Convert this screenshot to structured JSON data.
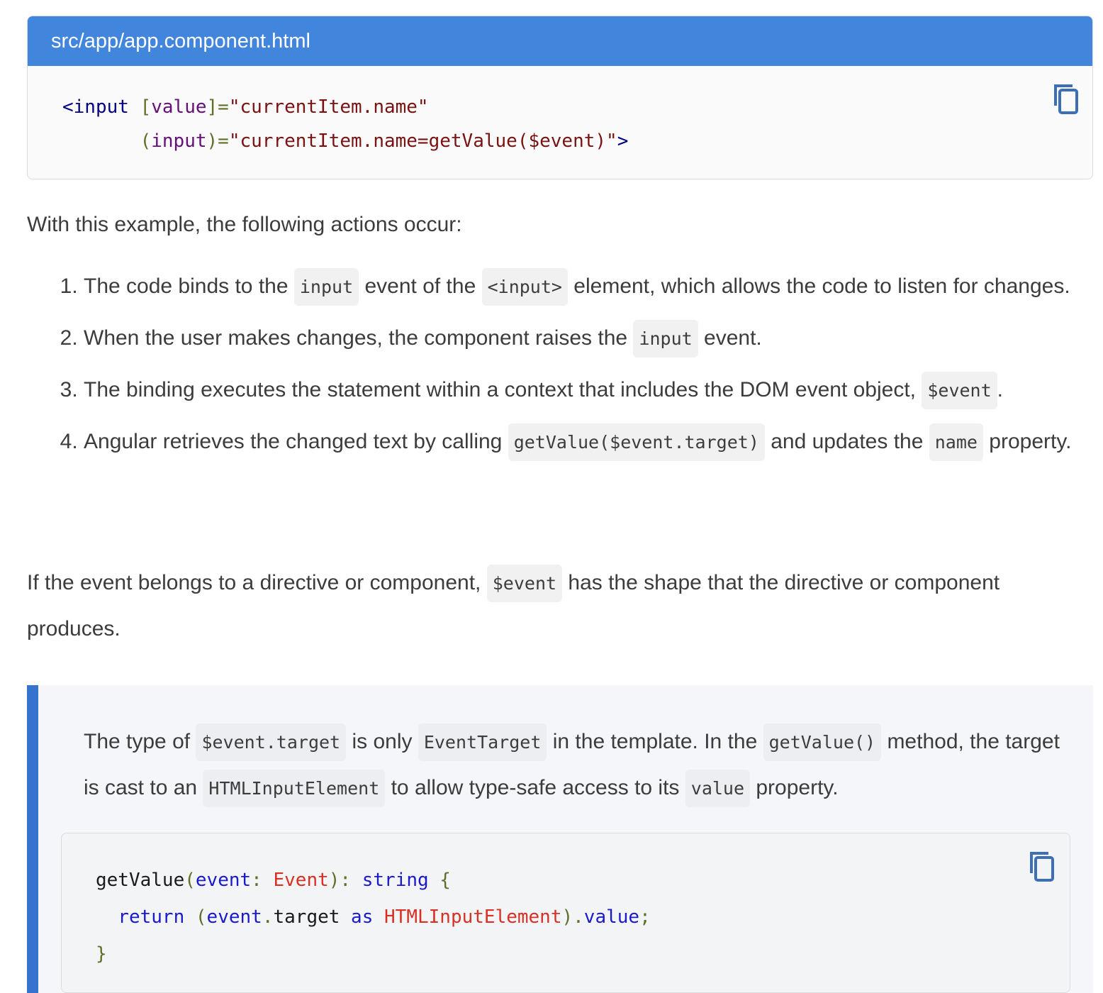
{
  "code_example_1": {
    "filename": "src/app/app.component.html",
    "copy_icon": "copy-icon",
    "lines": [
      {
        "tokens": [
          {
            "type": "tag",
            "text": "<input "
          },
          {
            "type": "punct",
            "text": "["
          },
          {
            "type": "attr",
            "text": "value"
          },
          {
            "type": "punct",
            "text": "]="
          },
          {
            "type": "str",
            "text": "\"currentItem.name\""
          }
        ]
      },
      {
        "tokens": [
          {
            "type": "plain",
            "text": "       "
          },
          {
            "type": "punct",
            "text": "("
          },
          {
            "type": "attr",
            "text": "input"
          },
          {
            "type": "punct",
            "text": ")="
          },
          {
            "type": "str",
            "text": "\"currentItem.name=getValue($event)\""
          },
          {
            "type": "tag",
            "text": ">"
          }
        ]
      }
    ]
  },
  "intro": "With this example, the following actions occur:",
  "steps": [
    {
      "parts": [
        {
          "text": "The code binds to the "
        },
        {
          "code": "input"
        },
        {
          "text": " event of the "
        },
        {
          "code": "<input>"
        },
        {
          "text": " element, which allows the code to listen for changes."
        }
      ]
    },
    {
      "parts": [
        {
          "text": "When the user makes changes, the component raises the "
        },
        {
          "code": "input"
        },
        {
          "text": " event."
        }
      ]
    },
    {
      "parts": [
        {
          "text": "The binding executes the statement within a context that includes the DOM event object, "
        },
        {
          "code": "$event"
        },
        {
          "text": "."
        }
      ]
    },
    {
      "parts": [
        {
          "text": "Angular retrieves the changed text by calling "
        },
        {
          "code": "getValue($event.target)"
        },
        {
          "text": " and updates the "
        },
        {
          "code": "name"
        },
        {
          "text": " property."
        }
      ]
    }
  ],
  "paragraph_2": {
    "parts": [
      {
        "text": "If the event belongs to a directive or component, "
      },
      {
        "code": "$event"
      },
      {
        "text": " has the shape that the directive or component produces."
      }
    ]
  },
  "callout": {
    "parts": [
      {
        "text": "The type of "
      },
      {
        "code": "$event.target"
      },
      {
        "text": " is only "
      },
      {
        "code": "EventTarget"
      },
      {
        "text": " in the template. In the "
      },
      {
        "code": "getValue()"
      },
      {
        "text": " method, the target is cast to an "
      },
      {
        "code": "HTMLInputElement"
      },
      {
        "text": " to allow type-safe access to its "
      },
      {
        "code": "value"
      },
      {
        "text": " property."
      }
    ],
    "code": {
      "copy_icon": "copy-icon",
      "lines": [
        {
          "tokens": [
            {
              "type": "fn",
              "text": "getValue"
            },
            {
              "type": "punct",
              "text": "("
            },
            {
              "type": "kw",
              "text": "event"
            },
            {
              "type": "punct",
              "text": ": "
            },
            {
              "type": "type",
              "text": "Event"
            },
            {
              "type": "punct",
              "text": "): "
            },
            {
              "type": "kw",
              "text": "string"
            },
            {
              "type": "punct",
              "text": " {"
            }
          ]
        },
        {
          "tokens": [
            {
              "type": "plain",
              "text": "  "
            },
            {
              "type": "kw",
              "text": "return"
            },
            {
              "type": "punct",
              "text": " ("
            },
            {
              "type": "kw",
              "text": "event"
            },
            {
              "type": "punct",
              "text": "."
            },
            {
              "type": "ident",
              "text": "target"
            },
            {
              "type": "kw",
              "text": " as "
            },
            {
              "type": "type",
              "text": "HTMLInputElement"
            },
            {
              "type": "punct",
              "text": ")."
            },
            {
              "type": "kw",
              "text": "value"
            },
            {
              "type": "punct",
              "text": ";"
            }
          ]
        },
        {
          "tokens": [
            {
              "type": "punct",
              "text": "}"
            }
          ]
        }
      ]
    }
  }
}
